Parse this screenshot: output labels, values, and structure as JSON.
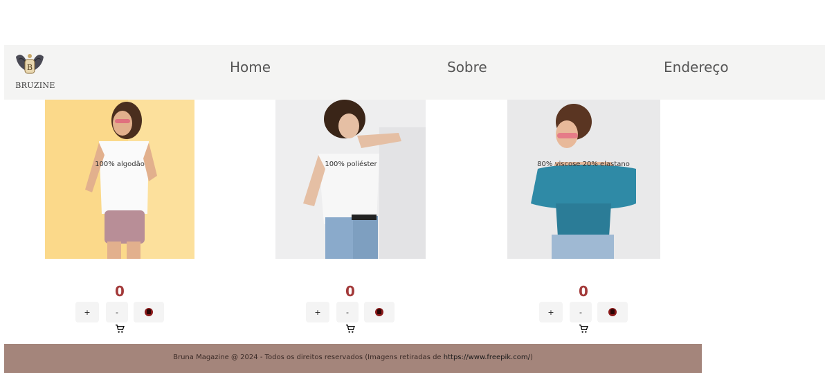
{
  "brand": {
    "name": "BRUZINE",
    "logo_icon": "winged-crest-icon"
  },
  "nav": {
    "home": "Home",
    "about": "Sobre",
    "address": "Endereço"
  },
  "products": [
    {
      "description": "100% algodão",
      "count": "0",
      "plus": "+",
      "minus": "-"
    },
    {
      "description": "100% poliéster",
      "count": "0",
      "plus": "+",
      "minus": "-"
    },
    {
      "description": "80% viscose 20% elastano",
      "count": "0",
      "plus": "+",
      "minus": "-"
    }
  ],
  "footer": {
    "text": "Bruna Magazine @ 2024 - Todos os direitos reservados (Imagens retiradas de ",
    "link": "https://www.freepik.com/",
    "close": ")"
  },
  "colors": {
    "navbar_bg": "#f4f4f3",
    "footer_bg": "#a4857b",
    "counter": "#a33a3a",
    "delete_icon": "#8b1a1a"
  }
}
